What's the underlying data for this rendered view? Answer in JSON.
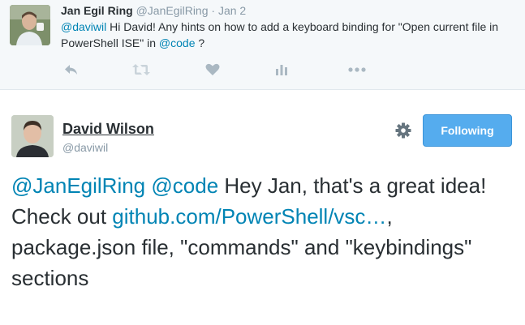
{
  "parent_tweet": {
    "fullname": "Jan Egil Ring",
    "screen_name": "@JanEgilRing",
    "separator": "·",
    "timestamp": "Jan 2",
    "mention": "@daviwil",
    "text_part1": " Hi David! Any hints on how to add a keyboard binding for \"Open current file in PowerShell ISE\" in ",
    "mention2": "@code",
    "text_part2": " ?",
    "actions": [
      "reply-icon",
      "retweet-icon",
      "like-icon",
      "analytics-icon",
      "more-icon"
    ]
  },
  "main_tweet": {
    "fullname": "David Wilson",
    "screen_name": "@daviwil",
    "follow_label": "Following",
    "mention1": "@JanEgilRing",
    "mention2": "@code",
    "text_part1": " Hey Jan, that's a great idea! Check out ",
    "link": "github.com/PowerShell/vsc…",
    "text_part2": ", package.json file, \"commands\" and \"keybindings\" sections"
  },
  "colors": {
    "link": "#0084b4",
    "follow_button": "#55acee",
    "muted": "#8899a6",
    "text": "#292f33",
    "parent_bg": "#f5f8fa"
  }
}
